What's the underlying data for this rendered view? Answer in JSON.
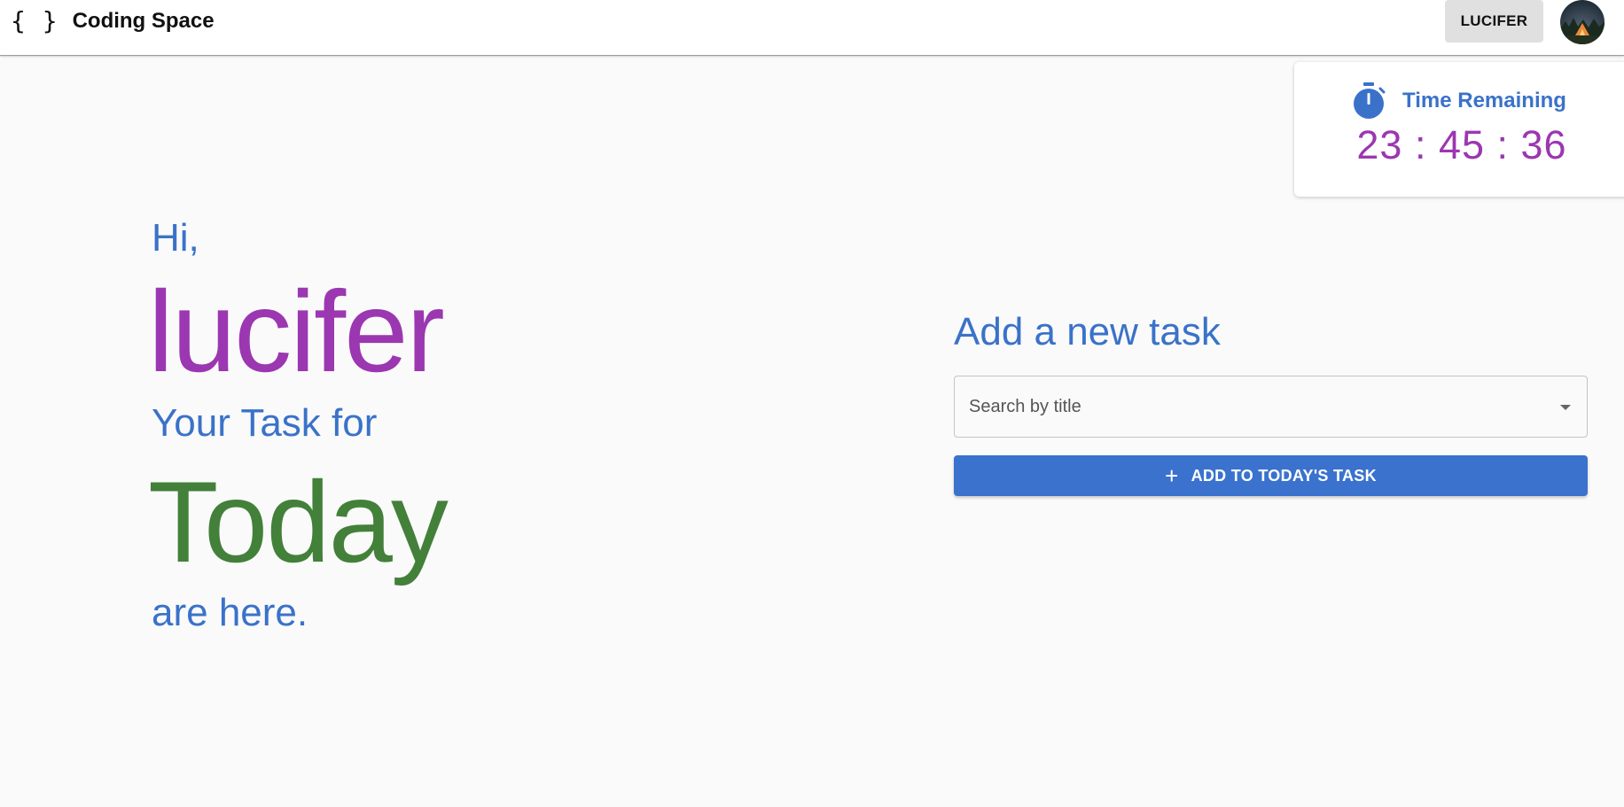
{
  "appbar": {
    "brand_icon": "{ }",
    "brand_title": "Coding Space",
    "user_button": "LUCIFER"
  },
  "timer": {
    "title": "Time Remaining",
    "value": "23 : 45 : 36"
  },
  "greeting": {
    "hi": "Hi,",
    "name": "lucifer",
    "line2": "Your Task for",
    "day": "Today",
    "line3": "are here."
  },
  "add_task": {
    "title": "Add a new task",
    "search_placeholder": "Search by title",
    "button_label": "ADD TO TODAY'S TASK"
  },
  "colors": {
    "primary": "#3a72cd",
    "purple": "#9b37b0",
    "green": "#43803a"
  }
}
